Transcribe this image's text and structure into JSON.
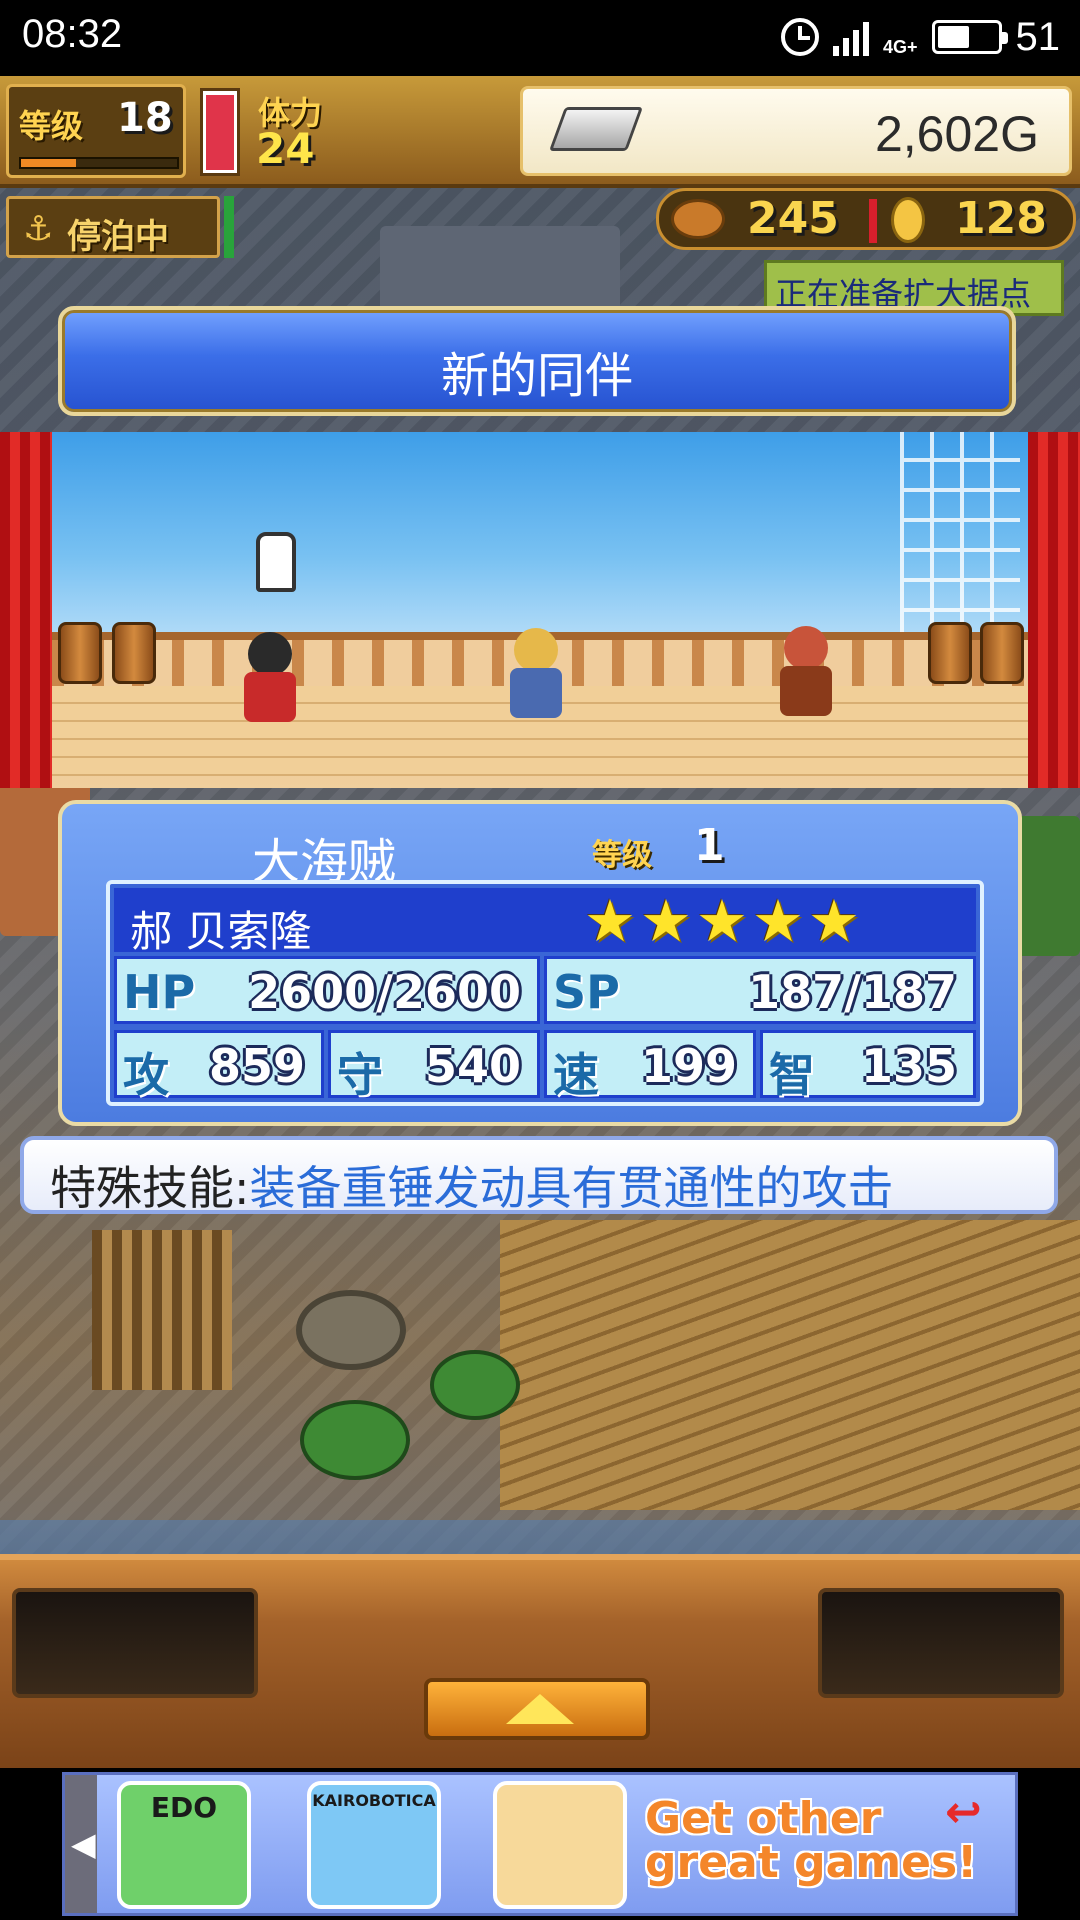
{
  "status_bar": {
    "time": "08:32",
    "network": "4G+",
    "battery_percent": "51",
    "battery_level": 0.55
  },
  "hud": {
    "level_label": "等级",
    "level_value": "18",
    "xp_fraction": 0.35,
    "stamina_label": "体力",
    "stamina_value": "24",
    "stamina_fraction": 0.95,
    "gold_value": "2,602G",
    "status_label": "停泊中",
    "food_count": "245",
    "coin_count": "128",
    "notice_text": "正在准备扩大据点"
  },
  "dialog": {
    "title": "新的同伴"
  },
  "character": {
    "job": "大海贼",
    "level_label": "等级",
    "level_value": "1",
    "name": "郝 贝索隆",
    "stars": 5,
    "stats": {
      "hp_label": "HP",
      "hp_value": "2600/2600",
      "sp_label": "SP",
      "sp_value": "187/187",
      "atk_label": "攻",
      "atk_value": "859",
      "def_label": "守",
      "def_value": "540",
      "spd_label": "速",
      "spd_value": "199",
      "int_label": "智",
      "int_value": "135"
    },
    "skill_label": "特殊技能:",
    "skill_desc": "装备重锤发动具有贯通性的攻击"
  },
  "ad_banner": {
    "apps": [
      {
        "label": "EDO",
        "color": "#6fd06a"
      },
      {
        "label": "KAIROBOTICA",
        "color": "#7ec8f5"
      },
      {
        "label": "",
        "color": "#f7d99a"
      }
    ],
    "cta_line1": "Get other",
    "cta_line2": "great games!"
  }
}
